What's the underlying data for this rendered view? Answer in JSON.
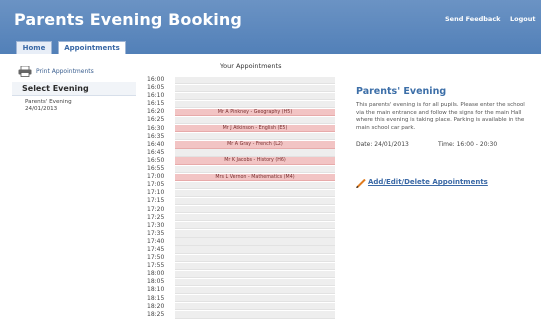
{
  "header": {
    "title": "Parents Evening Booking",
    "send_feedback": "Send Feedback",
    "logout": "Logout"
  },
  "tabs": [
    {
      "label": "Home"
    },
    {
      "label": "Appointments"
    }
  ],
  "sidebar": {
    "print_label": "Print Appointments",
    "select_heading": "Select Evening",
    "evenings": [
      {
        "name": "Parents' Evening",
        "date": "24/01/2013"
      }
    ]
  },
  "schedule": {
    "title": "Your Appointments",
    "slots": [
      {
        "time": "16:00",
        "appointment": ""
      },
      {
        "time": "16:05",
        "appointment": ""
      },
      {
        "time": "16:10",
        "appointment": ""
      },
      {
        "time": "16:15",
        "appointment": ""
      },
      {
        "time": "16:20",
        "appointment": "Mr A Pinkney - Geography (H5)"
      },
      {
        "time": "16:25",
        "appointment": ""
      },
      {
        "time": "16:30",
        "appointment": "Mr J Atkinson - English (E5)"
      },
      {
        "time": "16:35",
        "appointment": ""
      },
      {
        "time": "16:40",
        "appointment": "Mr A Gray - French (L2)"
      },
      {
        "time": "16:45",
        "appointment": ""
      },
      {
        "time": "16:50",
        "appointment": "Mr K Jacobs - History (H6)"
      },
      {
        "time": "16:55",
        "appointment": ""
      },
      {
        "time": "17:00",
        "appointment": "Mrs L Vernon - Mathematics (M4)"
      },
      {
        "time": "17:05",
        "appointment": ""
      },
      {
        "time": "17:10",
        "appointment": ""
      },
      {
        "time": "17:15",
        "appointment": ""
      },
      {
        "time": "17:20",
        "appointment": ""
      },
      {
        "time": "17:25",
        "appointment": ""
      },
      {
        "time": "17:30",
        "appointment": ""
      },
      {
        "time": "17:35",
        "appointment": ""
      },
      {
        "time": "17:40",
        "appointment": ""
      },
      {
        "time": "17:45",
        "appointment": ""
      },
      {
        "time": "17:50",
        "appointment": ""
      },
      {
        "time": "17:55",
        "appointment": ""
      },
      {
        "time": "18:00",
        "appointment": ""
      },
      {
        "time": "18:05",
        "appointment": ""
      },
      {
        "time": "18:10",
        "appointment": ""
      },
      {
        "time": "18:15",
        "appointment": ""
      },
      {
        "time": "18:20",
        "appointment": ""
      },
      {
        "time": "18:25",
        "appointment": ""
      }
    ]
  },
  "info": {
    "title": "Parents' Evening",
    "description": "This parents' evening is for all pupils. Please enter the school via the main entrance and follow the signs for the main Hall where this evening is taking place. Parking is available in the main school car park.",
    "date_text": "Date: 24/01/2013",
    "time_text": "Time: 16:00 - 20:30",
    "manage_link": "Add/Edit/Delete Appointments"
  },
  "colors": {
    "header": "#5a86bd",
    "booked_slot": "#f2c4c4",
    "empty_slot": "#eeeeee",
    "link": "#3b69a6"
  },
  "icons": {
    "print": "printer-icon",
    "manage": "pencil-icon"
  }
}
